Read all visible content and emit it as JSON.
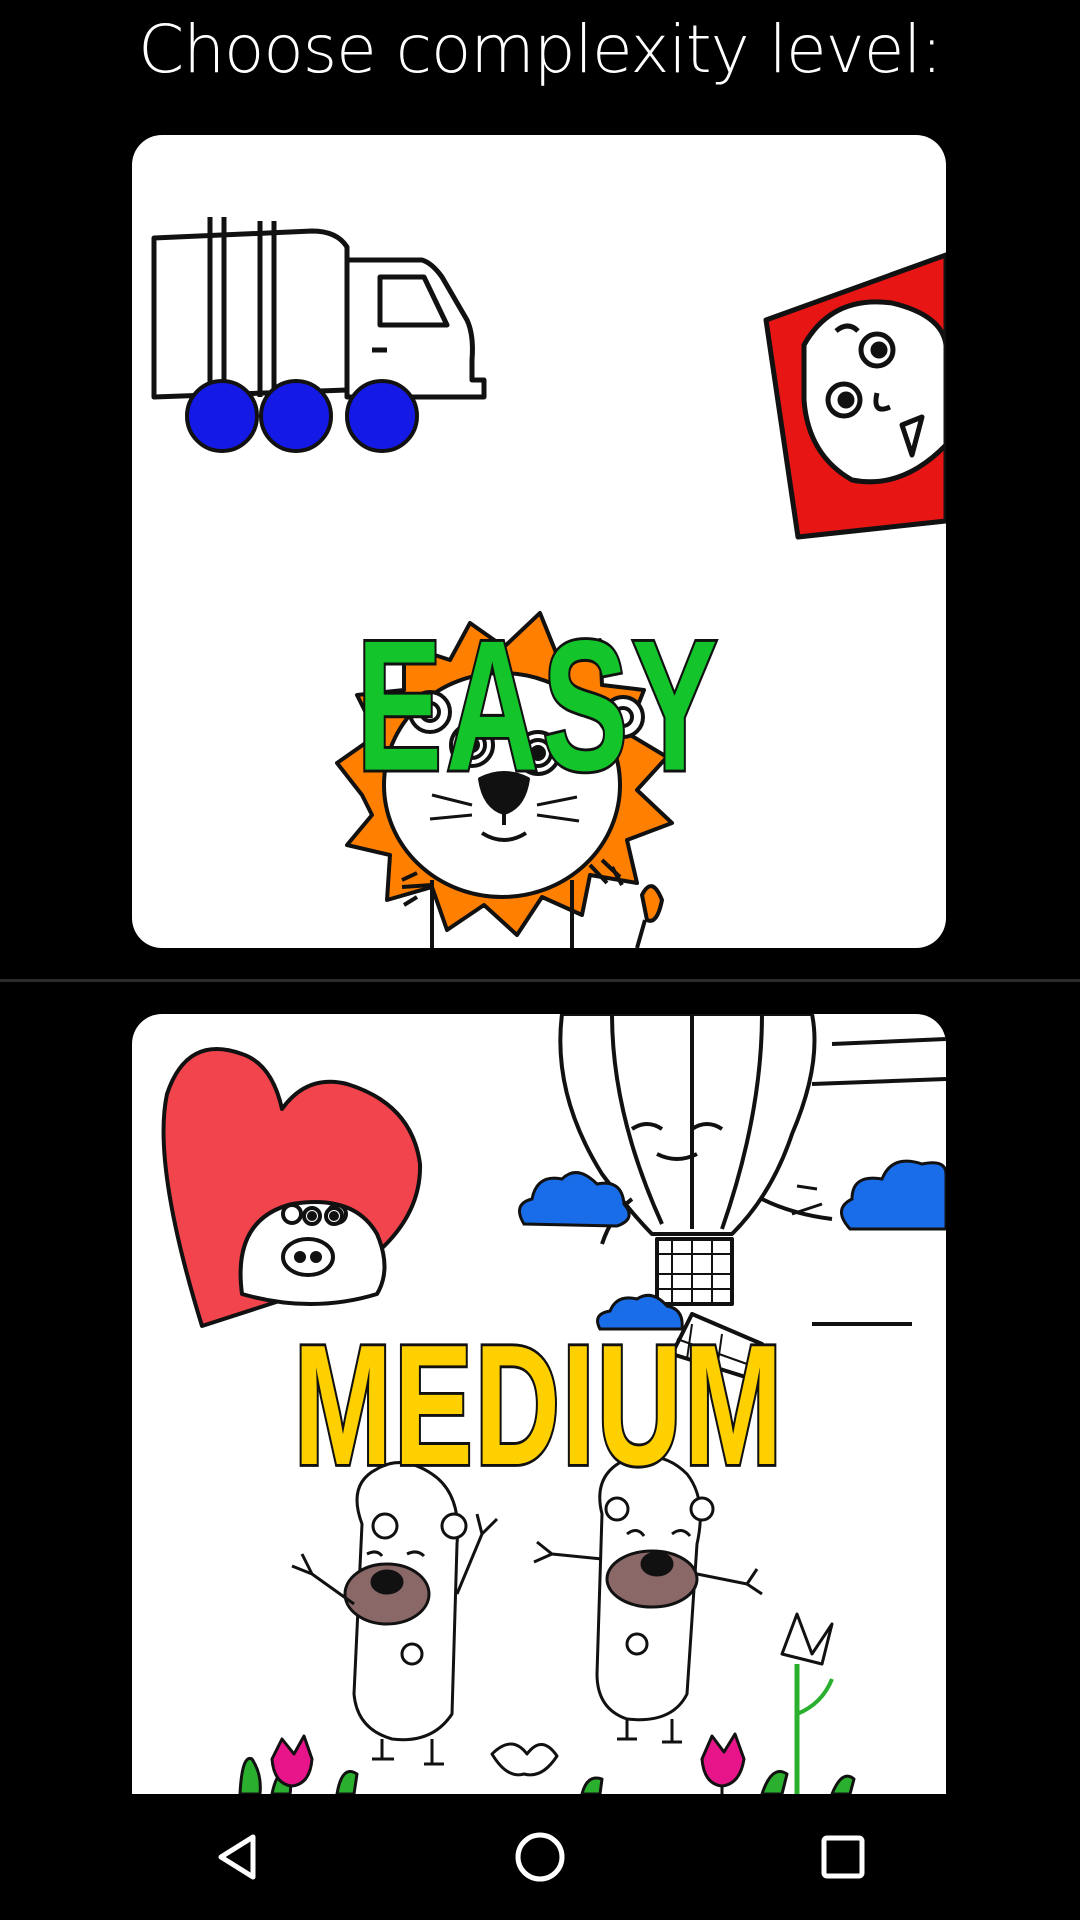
{
  "screen": {
    "title": "Choose complexity level:"
  },
  "levels": [
    {
      "label": "EASY",
      "color": "#13c42b"
    },
    {
      "label": "MEDIUM",
      "color": "#ffd000"
    }
  ],
  "navbar": {
    "buttons": [
      "back-icon",
      "home-icon",
      "recents-icon"
    ]
  }
}
